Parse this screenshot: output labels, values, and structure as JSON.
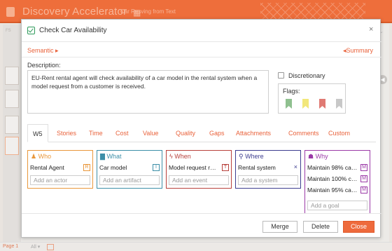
{
  "app": {
    "title": "Discovery Accelerator",
    "grid_icon": "grid-icon",
    "tab_label": "Car Resving from Text",
    "side_label": "FS",
    "page_label": "Page 1",
    "all_label": "All ▾",
    "right_dot": "◀",
    "right_glyph": "⌄"
  },
  "modal": {
    "title": "Check Car Availability",
    "close_icon": "×",
    "nav_prev": "Semantic ▸",
    "nav_next": "◂Summary",
    "description_label": "Description:",
    "description_text": "EU-Rent rental agent will check availability of a car model in the rental system when a model request from a customer is received.",
    "discretionary_label": "Discretionary",
    "flags_label": "Flags:",
    "flags": [
      {
        "name": "green-flag",
        "color": "#8fc08f"
      },
      {
        "name": "yellow-flag",
        "color": "#f2e77a"
      },
      {
        "name": "red-flag",
        "color": "#e07a73"
      },
      {
        "name": "grey-flag",
        "color": "#c8c8c8"
      }
    ],
    "tabs": [
      "W5",
      "Stories",
      "Time",
      "Cost",
      "Value",
      "Quality",
      "Gaps",
      "Attachments",
      "Comments",
      "Custom"
    ],
    "w5": {
      "who": {
        "icon": "person-icon",
        "title": "Who",
        "color": "#e9973b",
        "items": [
          {
            "text": "Rental Agent",
            "badge": "R"
          }
        ],
        "placeholder": "Add an actor"
      },
      "what": {
        "icon": "document-icon",
        "title": "What",
        "color": "#3d8fa8",
        "items": [
          {
            "text": "Car model",
            "badge": "I"
          }
        ],
        "placeholder": "Add an artifact"
      },
      "when": {
        "icon": "lightning-icon",
        "title": "When",
        "color": "#b8413c",
        "items": [
          {
            "text": "Model request rec...",
            "badge": "T"
          }
        ],
        "placeholder": "Add an event"
      },
      "where": {
        "icon": "location-pin-icon",
        "title": "Where",
        "color": "#3d3d8f",
        "items": [
          {
            "text": "Rental system",
            "badge": "×"
          }
        ],
        "placeholder": "Add a system"
      },
      "why": {
        "icon": "goal-icon",
        "title": "Why",
        "color": "#9b3aa7",
        "items": [
          {
            "text": "Maintain 98% car...",
            "badge": "M"
          },
          {
            "text": "Maintain 100% ca...",
            "badge": "M"
          },
          {
            "text": "Maintain 95% car...",
            "badge": "M"
          }
        ],
        "placeholder": "Add a goal"
      }
    },
    "buttons": {
      "merge": "Merge",
      "delete": "Delete",
      "close": "Close"
    }
  }
}
